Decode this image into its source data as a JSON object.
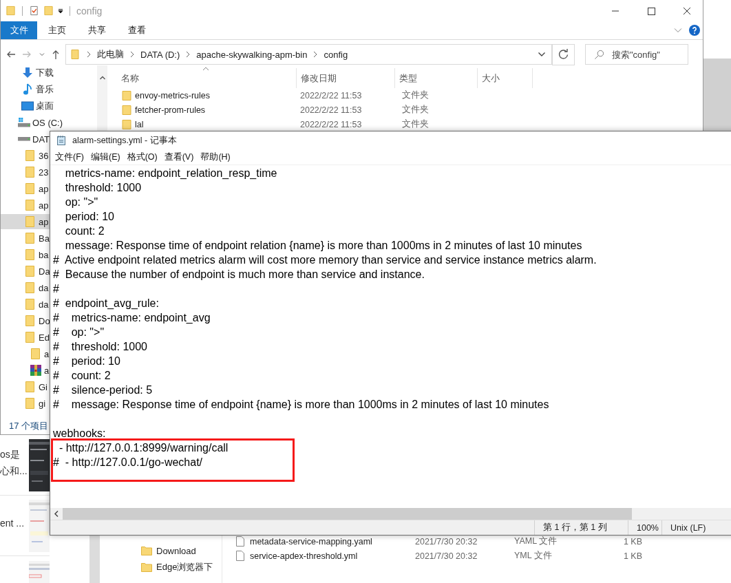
{
  "explorer": {
    "title": "config",
    "ribbon_tabs": [
      {
        "label": "文件",
        "selected": true
      },
      {
        "label": "主页",
        "selected": false
      },
      {
        "label": "共享",
        "selected": false
      },
      {
        "label": "查看",
        "selected": false
      }
    ],
    "breadcrumb": [
      "此电脑",
      "DATA (D:)",
      "apache-skywalking-apm-bin",
      "config"
    ],
    "search": {
      "placeholder": "搜索\"config\""
    },
    "columns": [
      "名称",
      "修改日期",
      "类型",
      "大小"
    ],
    "rows": [
      {
        "name": "envoy-metrics-rules",
        "modified": "2022/2/22 11:53",
        "type": "文件夹"
      },
      {
        "name": "fetcher-prom-rules",
        "modified": "2022/2/22 11:53",
        "type": "文件夹"
      },
      {
        "name": "lal",
        "modified": "2022/2/22 11:53",
        "type": "文件夹"
      }
    ],
    "nav_items": [
      {
        "label": "下载",
        "kind": "download",
        "selected": false
      },
      {
        "label": "音乐",
        "kind": "music",
        "selected": false
      },
      {
        "label": "桌面",
        "kind": "desktop",
        "selected": false
      },
      {
        "label": "OS (C:)",
        "kind": "system-drive",
        "selected": false
      },
      {
        "label": "DAT",
        "kind": "drive",
        "selected": false
      },
      {
        "label": "36",
        "kind": "folder",
        "selected": false
      },
      {
        "label": "23",
        "kind": "folder",
        "selected": false
      },
      {
        "label": "ap",
        "kind": "folder",
        "selected": false
      },
      {
        "label": "ap",
        "kind": "folder",
        "selected": false
      },
      {
        "label": "ap",
        "kind": "folder",
        "selected": true
      },
      {
        "label": "Ba",
        "kind": "folder",
        "selected": false
      },
      {
        "label": "ba",
        "kind": "folder",
        "selected": false
      },
      {
        "label": "Da",
        "kind": "folder",
        "selected": false
      },
      {
        "label": "da",
        "kind": "folder",
        "selected": false
      },
      {
        "label": "da",
        "kind": "folder",
        "selected": false
      },
      {
        "label": "Do",
        "kind": "folder",
        "selected": false
      },
      {
        "label": "Ed",
        "kind": "folder",
        "selected": false,
        "children": [
          {
            "label": "a",
            "kind": "folder",
            "selected": false
          },
          {
            "label": "a",
            "kind": "archive",
            "selected": false
          }
        ]
      },
      {
        "label": "Gi",
        "kind": "folder",
        "selected": false
      },
      {
        "label": "gi",
        "kind": "folder",
        "selected": false
      }
    ],
    "status": "17 个项目"
  },
  "notepad": {
    "title": "alarm-settings.yml - 记事本",
    "menu": [
      "文件(F)",
      "编辑(E)",
      "格式(O)",
      "查看(V)",
      "帮助(H)"
    ],
    "blocks": [
      {
        "kind": "text",
        "lines": [
          "    metrics-name: endpoint_relation_resp_time",
          "    threshold: 1000",
          "    op: \">\"",
          "    period: 10",
          "    count: 2",
          "    message: Response time of endpoint relation {name} is more than 1000ms in 2 minutes of last 10 minutes",
          "#  Active endpoint related metrics alarm will cost more memory than service and service instance metrics alarm.",
          "#  Because the number of endpoint is much more than service and instance.",
          "#",
          "#  endpoint_avg_rule:",
          "#    metrics-name: endpoint_avg",
          "#    op: \">\"",
          "#    threshold: 1000",
          "#    period: 10",
          "#    count: 2",
          "#    silence-period: 5",
          "#    message: Response time of endpoint {name} is more than 1000ms in 2 minutes of last 10 minutes"
        ]
      },
      {
        "kind": "text",
        "lines": [
          "webhooks:"
        ]
      },
      {
        "kind": "highlight",
        "lines": [
          "  - http://127.0.0.1:8999/warning/call",
          "#  - http://127.0.0.1/go-wechat/"
        ]
      }
    ],
    "status": {
      "position": "第 1 行，第 1 列",
      "zoom": "100%",
      "line_ending": "Unix (LF)"
    }
  },
  "background_explorer": {
    "nav_items": [
      {
        "label": "Download"
      },
      {
        "label": "Edge浏览器下"
      }
    ],
    "rows": [
      {
        "name": "metadata-service-mapping.yaml",
        "modified": "2021/7/30 20:32",
        "type": "YAML 文件",
        "size": "1 KB"
      },
      {
        "name": "service-apdex-threshold.yml",
        "modified": "2021/7/30 20:32",
        "type": "YML 文件",
        "size": "1 KB"
      }
    ]
  },
  "web_page": {
    "items": [
      {
        "lines": [
          "os是",
          "心和..."
        ]
      },
      {
        "lines": [
          "ent ..."
        ]
      }
    ]
  }
}
